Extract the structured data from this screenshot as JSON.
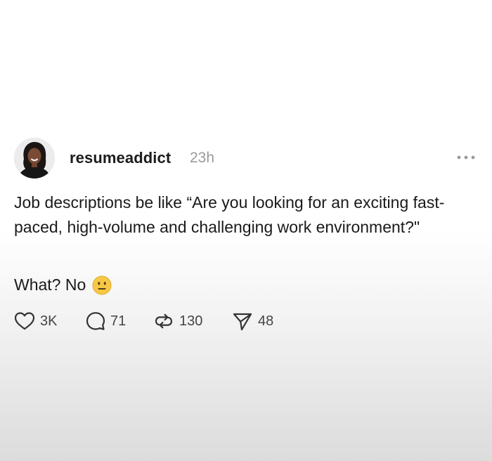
{
  "post": {
    "username": "resumeaddict",
    "timestamp": "23h",
    "body": "Job descriptions be like “Are you looking for an exciting fast-paced, high-volume and challenging work environment?\"",
    "reply_text": "What? No",
    "emoji": "neutral-face-emoji",
    "more_icon": "more-horizontal-icon"
  },
  "actions": {
    "likes": "3K",
    "replies": "71",
    "reposts": "130",
    "shares": "48"
  },
  "icons": {
    "like": "heart-icon",
    "reply": "comment-icon",
    "repost": "repost-icon",
    "share": "send-icon"
  }
}
